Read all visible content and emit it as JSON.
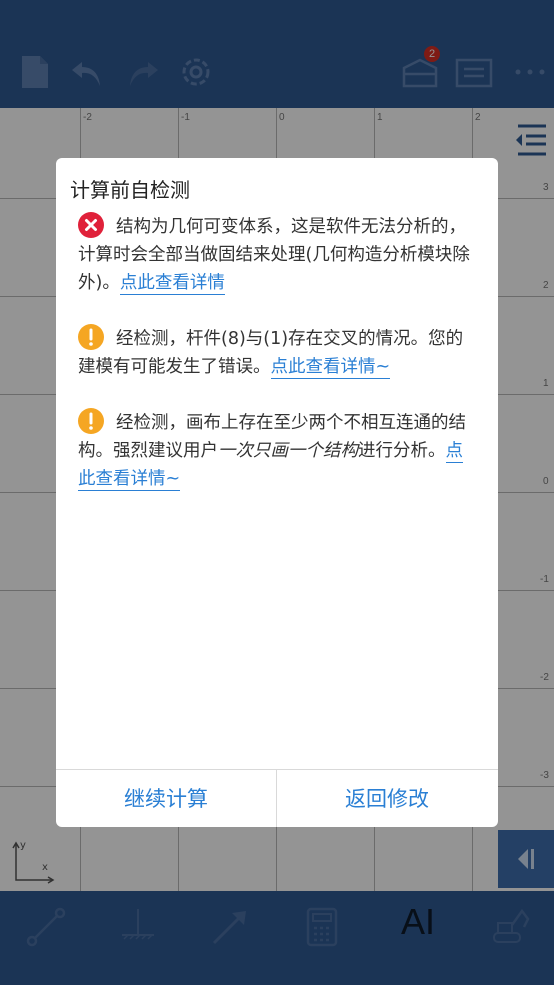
{
  "toolbar": {
    "icons": [
      "new-file-icon",
      "undo-icon",
      "redo-icon",
      "settings-icon",
      "inbox-icon",
      "list-icon",
      "more-icon"
    ],
    "badge_count": "2"
  },
  "canvas": {
    "x_ticks": [
      "-2",
      "-1",
      "0",
      "1",
      "2"
    ],
    "y_ticks": [
      "3",
      "2",
      "1",
      "0",
      "-1",
      "-2",
      "-3"
    ],
    "axis_x": "x",
    "axis_y": "y"
  },
  "dialog": {
    "title": "计算前自检测",
    "messages": [
      {
        "level": "error",
        "text": "结构为几何可变体系，这是软件无法分析的，计算时会全部当做固结来处理(几何构造分析模块除外)。",
        "link": "点此查看详情"
      },
      {
        "level": "warning",
        "text": "经检测，杆件(8)与(1)存在交叉的情况。您的建模有可能发生了错误。",
        "link": "点此查看详情~"
      },
      {
        "level": "warning",
        "text_before": "经检测，画布上存在至少两个不相互连通的结构。强烈建议用户",
        "text_italic": "一次只画一个结构",
        "text_after": "进行分析。",
        "link": "点此查看详情~"
      }
    ],
    "buttons": {
      "continue": "继续计算",
      "back": "返回修改"
    }
  },
  "bottom_toolbar": {
    "icons": [
      "bar-element-icon",
      "support-icon",
      "force-arrow-icon",
      "calculator-icon",
      "ai-label",
      "excavator-icon"
    ],
    "ai_label": "AI"
  },
  "colors": {
    "bar": "#2f5a93",
    "link": "#2a7fd4",
    "error": "#e0213a",
    "warning": "#f5a623"
  }
}
